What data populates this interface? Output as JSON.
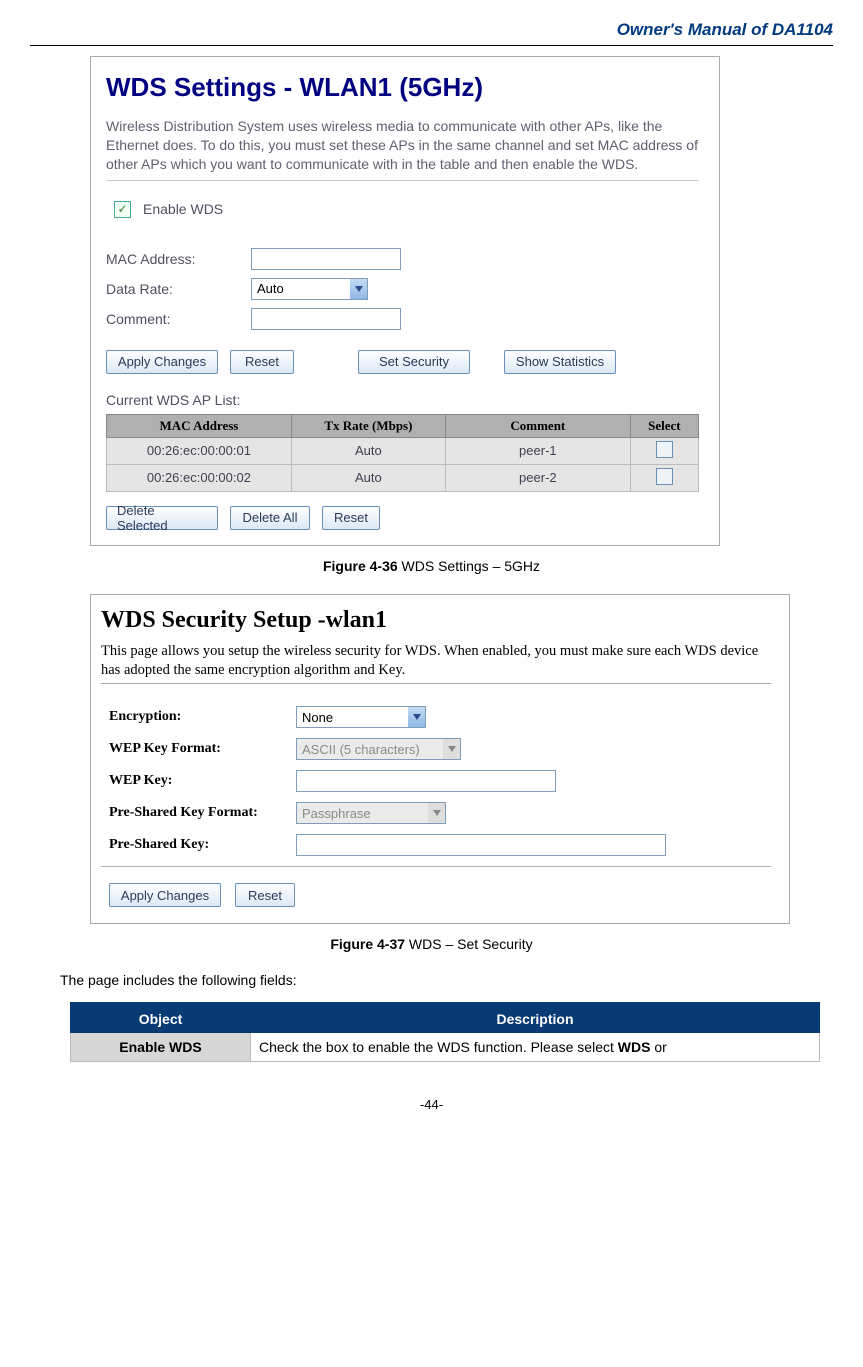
{
  "header": {
    "title": "Owner's Manual of DA1104"
  },
  "fig1": {
    "title": "WDS Settings - WLAN1 (5GHz)",
    "desc": "Wireless Distribution System uses wireless media to communicate with other APs, like the Ethernet does. To do this, you must set these APs in the same channel and set MAC address of other APs which you want to communicate with in the table and then enable the WDS.",
    "enable_label": "Enable WDS",
    "mac_label": "MAC Address:",
    "rate_label": "Data Rate:",
    "rate_value": "Auto",
    "comment_label": "Comment:",
    "btn_apply": "Apply Changes",
    "btn_reset": "Reset",
    "btn_sec": "Set Security",
    "btn_stats": "Show Statistics",
    "list_label": "Current WDS AP List:",
    "th1": "MAC Address",
    "th2": "Tx Rate (Mbps)",
    "th3": "Comment",
    "th4": "Select",
    "rows": [
      {
        "mac": "00:26:ec:00:00:01",
        "rate": "Auto",
        "comment": "peer-1"
      },
      {
        "mac": "00:26:ec:00:00:02",
        "rate": "Auto",
        "comment": "peer-2"
      }
    ],
    "btn_delsel": "Delete Selected",
    "btn_delall": "Delete All",
    "btn_reset2": "Reset",
    "caption_bold": "Figure 4-36",
    "caption_rest": " WDS Settings – 5GHz"
  },
  "fig2": {
    "title": "WDS Security Setup -wlan1",
    "desc": "This page allows you setup the wireless security for WDS. When enabled, you must make sure each WDS device has adopted the same encryption algorithm and Key.",
    "enc_label": "Encryption:",
    "enc_value": "None",
    "wepfmt_label": "WEP Key Format:",
    "wepfmt_value": "ASCII (5 characters)",
    "wepkey_label": "WEP Key:",
    "pskfmt_label": "Pre-Shared Key Format:",
    "pskfmt_value": "Passphrase",
    "psk_label": "Pre-Shared Key:",
    "btn_apply": "Apply Changes",
    "btn_reset": "Reset",
    "caption_bold": "Figure 4-37",
    "caption_rest": " WDS – Set Security"
  },
  "intro": "The page includes the following fields:",
  "table": {
    "h1": "Object",
    "h2": "Description",
    "row1_obj": "Enable WDS",
    "row1_desc_a": "Check the box to enable the WDS function. Please select ",
    "row1_desc_bold": "WDS",
    "row1_desc_b": " or"
  },
  "pageno": "-44-"
}
